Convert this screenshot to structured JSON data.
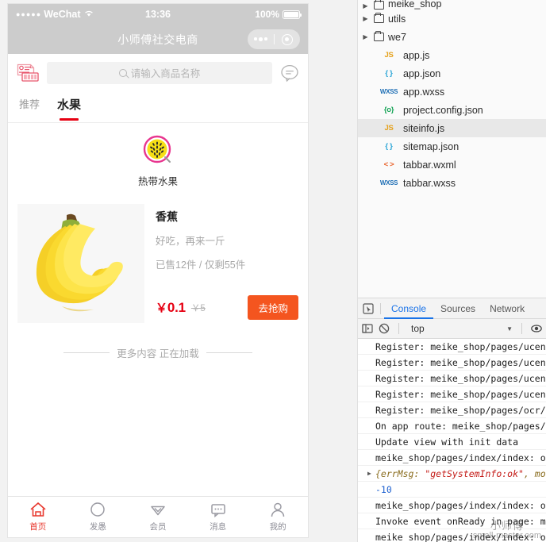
{
  "simulator": {
    "statusbar": {
      "signal_dots": "●●●●●",
      "carrier": "WeChat",
      "wifi_icon": "wifi-icon",
      "time": "13:36",
      "battery_percent": "100%"
    },
    "navbar": {
      "title": "小师傅社交电商",
      "menu_icon": "more-dots-icon",
      "close_icon": "target-circle-icon"
    },
    "search": {
      "coupon_icon": "certificate-icon",
      "search_icon": "search-icon",
      "placeholder": "请输入商品名称",
      "chat_icon": "chat-bubble-icon"
    },
    "tabs": [
      {
        "label": "推荐",
        "active": false
      },
      {
        "label": "水果",
        "active": true
      }
    ],
    "categories": [
      {
        "icon": "passion-fruit-icon",
        "label": "热带水果"
      }
    ],
    "product": {
      "image_icon": "banana-image",
      "title": "香蕉",
      "desc": "好吃，再来一斤",
      "stock": "已售12件 / 仅剩55件",
      "price": "0.1",
      "currency": "￥",
      "old_price": "￥5",
      "buy_label": "去抢购"
    },
    "loading_text": "更多内容 正在加载",
    "tabbar": [
      {
        "icon": "home-icon",
        "label": "首页",
        "active": true
      },
      {
        "icon": "circle-icon",
        "label": "发愚",
        "active": false
      },
      {
        "icon": "diamond-icon",
        "label": "会员",
        "active": false
      },
      {
        "icon": "message-icon",
        "label": "消息",
        "active": false
      },
      {
        "icon": "person-icon",
        "label": "我的",
        "active": false
      }
    ]
  },
  "devtools": {
    "filetree": [
      {
        "name": "meike_shop",
        "kind": "folder",
        "badge": "",
        "arrow": true,
        "indent": 0,
        "selected": false,
        "clipped": true
      },
      {
        "name": "utils",
        "kind": "folder",
        "badge": "",
        "arrow": true,
        "indent": 0,
        "selected": false
      },
      {
        "name": "we7",
        "kind": "folder",
        "badge": "",
        "arrow": true,
        "indent": 0,
        "selected": false
      },
      {
        "name": "app.js",
        "kind": "file",
        "badge": "JS",
        "arrow": false,
        "indent": 1,
        "selected": false
      },
      {
        "name": "app.json",
        "kind": "file",
        "badge": "{ }",
        "arrow": false,
        "indent": 1,
        "selected": false
      },
      {
        "name": "app.wxss",
        "kind": "file",
        "badge": "WXSS",
        "arrow": false,
        "indent": 1,
        "selected": false
      },
      {
        "name": "project.config.json",
        "kind": "file",
        "badge": "{o}",
        "arrow": false,
        "indent": 1,
        "selected": false
      },
      {
        "name": "siteinfo.js",
        "kind": "file",
        "badge": "JS",
        "arrow": false,
        "indent": 1,
        "selected": true
      },
      {
        "name": "sitemap.json",
        "kind": "file",
        "badge": "{ }",
        "arrow": false,
        "indent": 1,
        "selected": false
      },
      {
        "name": "tabbar.wxml",
        "kind": "file",
        "badge": "< >",
        "arrow": false,
        "indent": 1,
        "selected": false
      },
      {
        "name": "tabbar.wxss",
        "kind": "file",
        "badge": "WXSS",
        "arrow": false,
        "indent": 1,
        "selected": false
      }
    ],
    "panel_tabs": [
      {
        "label": "Console",
        "active": true
      },
      {
        "label": "Sources",
        "active": false
      },
      {
        "label": "Network",
        "active": false
      }
    ],
    "inspect_icon": "inspect-cursor-icon",
    "toolbar": {
      "sidebar_icon": "show-sidebar-icon",
      "clear_icon": "clear-console-icon",
      "context": "top",
      "caret_icon": "chevron-down-icon",
      "eye_icon": "eye-icon"
    },
    "console_lines": [
      {
        "type": "log",
        "text": "Register: meike_shop/pages/ucent"
      },
      {
        "type": "log",
        "text": "Register: meike_shop/pages/ucent"
      },
      {
        "type": "log",
        "text": "Register: meike_shop/pages/ucent"
      },
      {
        "type": "log",
        "text": "Register: meike_shop/pages/ucent"
      },
      {
        "type": "log",
        "text": "Register: meike_shop/pages/ocr/i"
      },
      {
        "type": "log",
        "text": "On app route: meike_shop/pages/i"
      },
      {
        "type": "log",
        "text": "Update view with init data"
      },
      {
        "type": "log",
        "text": "meike_shop/pages/index/index: on"
      },
      {
        "type": "obj",
        "text": "{errMsg: \"getSystemInfo:ok\", mo",
        "string_part": "\"getSystemInfo:ok\""
      },
      {
        "type": "num",
        "text": "-10"
      },
      {
        "type": "log",
        "text": "meike_shop/pages/index/index: on"
      },
      {
        "type": "log",
        "text": "Invoke event onReady in page: me"
      },
      {
        "type": "log",
        "text": "meike_shop/pages/index/index: on"
      }
    ],
    "watermark": {
      "cn": "小师傅",
      "en": "small-master.com"
    }
  },
  "colors": {
    "accent_red": "#e60012",
    "buy_orange": "#f4551f",
    "tab_active_red": "#e8382e",
    "devtools_blue": "#1a73e8",
    "status_gray": "#cccccc"
  }
}
